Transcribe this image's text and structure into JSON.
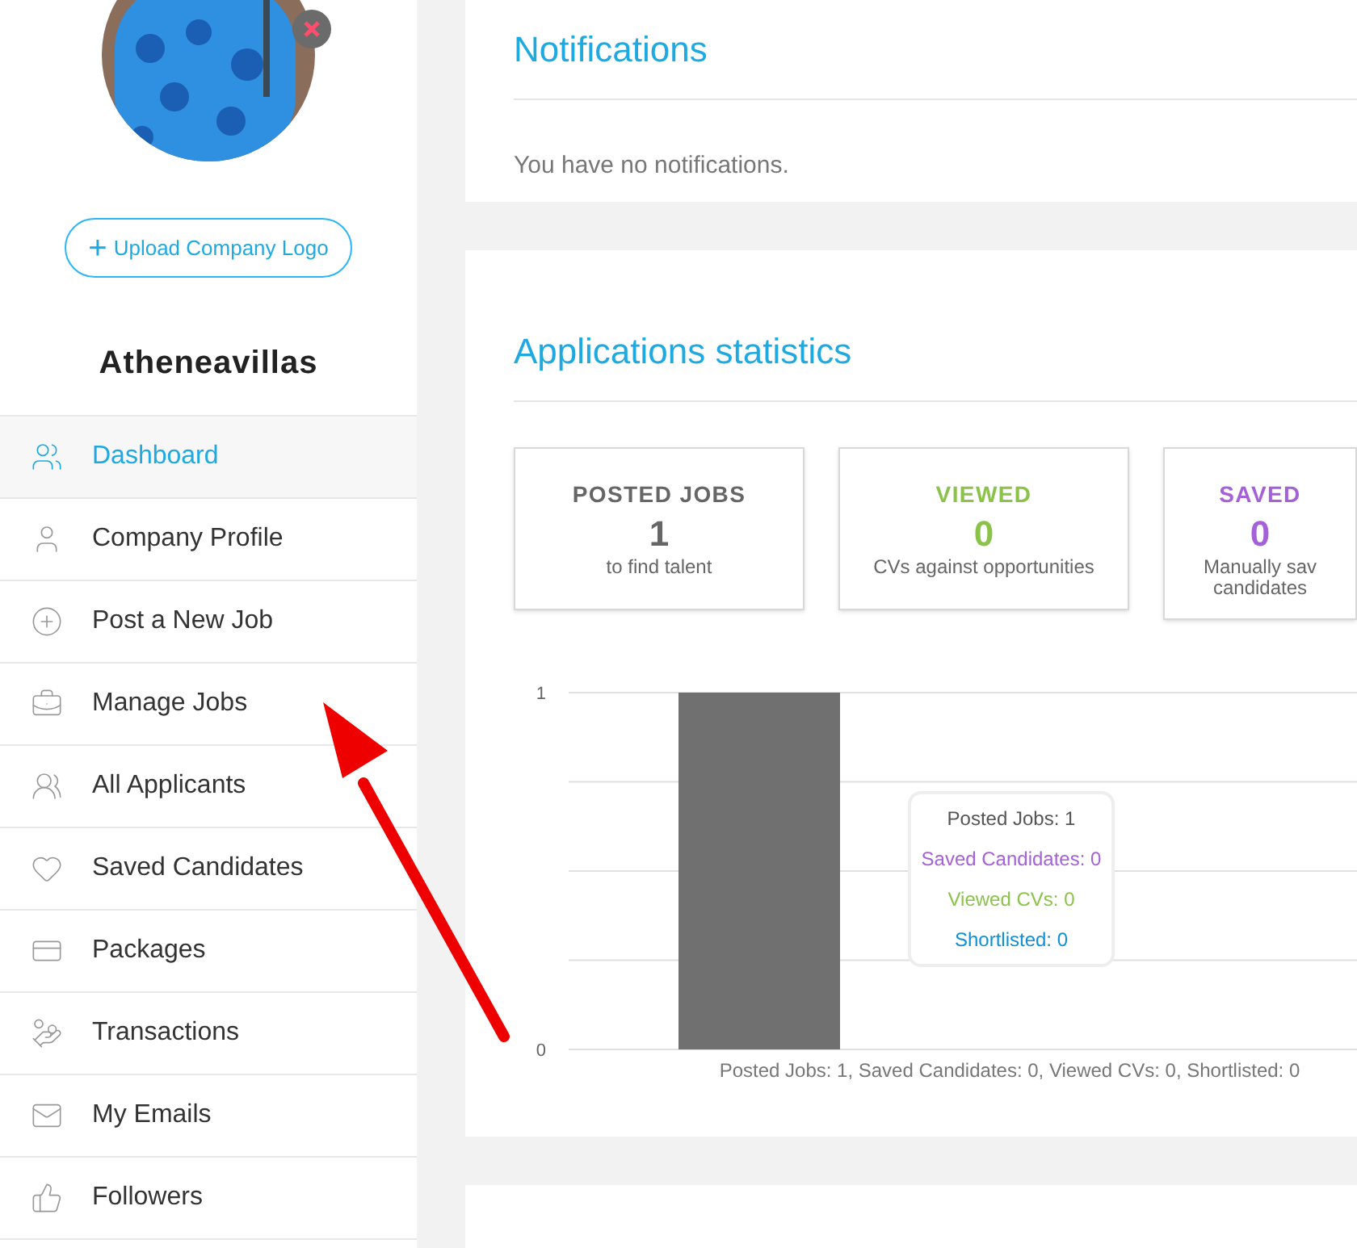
{
  "sidebar": {
    "upload_button": {
      "label": "Upload Company Logo",
      "icon": "+"
    },
    "company_name": "Atheneavillas",
    "items": [
      {
        "label": "Dashboard",
        "selected": true
      },
      {
        "label": "Company Profile",
        "selected": false
      },
      {
        "label": "Post a New Job",
        "selected": false
      },
      {
        "label": "Manage Jobs",
        "selected": false
      },
      {
        "label": "All Applicants",
        "selected": false
      },
      {
        "label": "Saved Candidates",
        "selected": false
      },
      {
        "label": "Packages",
        "selected": false
      },
      {
        "label": "Transactions",
        "selected": false
      },
      {
        "label": "My Emails",
        "selected": false
      },
      {
        "label": "Followers",
        "selected": false
      }
    ]
  },
  "notifications": {
    "title": "Notifications",
    "message": "You have no notifications."
  },
  "statistics": {
    "title": "Applications statistics",
    "cards": [
      {
        "label": "POSTED JOBS",
        "value": "1",
        "caption": "to find talent",
        "color": "#666666"
      },
      {
        "label": "VIEWED",
        "value": "0",
        "caption": "CVs against opportunities",
        "color": "#8bc34a"
      },
      {
        "label": "SAVED",
        "value": "0",
        "caption": "Manually sav\ncandidates",
        "color": "#a561d8"
      }
    ],
    "chart_data": {
      "type": "bar",
      "categories": [
        "Posted Jobs: 1, Saved Candidates: 0, Viewed CVs: 0, Shortlisted: 0"
      ],
      "series": [
        {
          "color": "#707070",
          "values": [
            1
          ]
        }
      ],
      "ylim": [
        0,
        1
      ],
      "yticks": [
        0,
        1
      ]
    },
    "tooltip": [
      {
        "text": "Posted Jobs: 1",
        "color": "#555555"
      },
      {
        "text": "Saved Candidates: 0",
        "color": "#a561d8"
      },
      {
        "text": "Viewed CVs: 0",
        "color": "#8bc34a"
      },
      {
        "text": "Shortlisted: 0",
        "color": "#0f8fd6"
      }
    ]
  }
}
